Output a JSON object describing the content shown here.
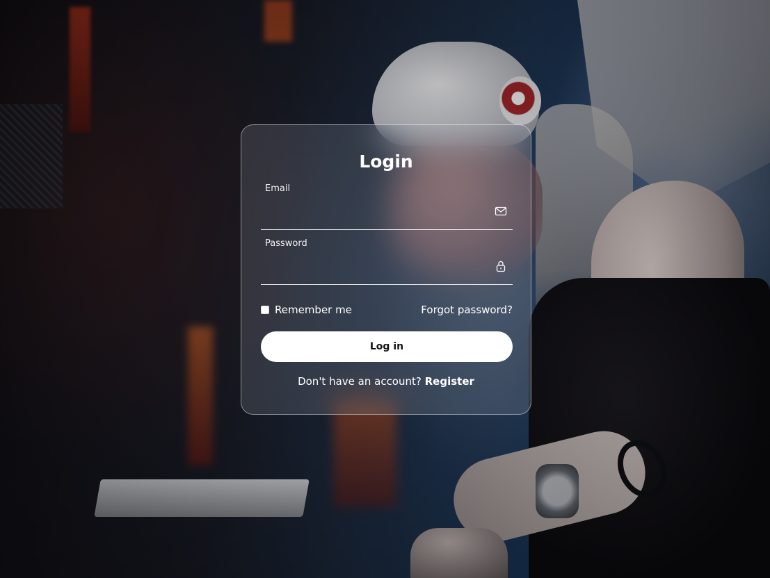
{
  "login": {
    "title": "Login",
    "email": {
      "label": "Email",
      "value": "",
      "icon": "envelope-icon"
    },
    "password": {
      "label": "Password",
      "value": "",
      "icon": "lock-icon"
    },
    "remember_label": "Remember me",
    "remember_checked": false,
    "forgot_label": "Forgot password?",
    "submit_label": "Log in",
    "register_prompt": "Don't have an account?",
    "register_label": "Register"
  },
  "colors": {
    "text": "#ffffff",
    "button_bg": "#ffffff",
    "button_text": "#111111",
    "card_border": "rgba(255,255,255,0.45)"
  }
}
